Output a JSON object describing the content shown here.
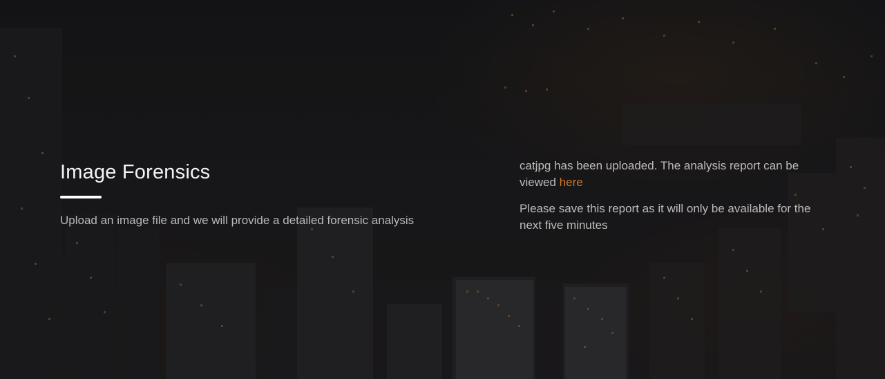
{
  "hero": {
    "title": "Image Forensics",
    "subtitle": "Upload an image file and we will provide a detailed forensic analysis"
  },
  "upload_status": {
    "message": "catjpg has been uploaded. The analysis report can be viewed",
    "link_label": "here",
    "warning": "Please save this report as it will only be available for the next five minutes"
  },
  "colors": {
    "link_accent": "#d1762a",
    "background": "#1c1c1d",
    "title_text": "#f4f4f4"
  }
}
